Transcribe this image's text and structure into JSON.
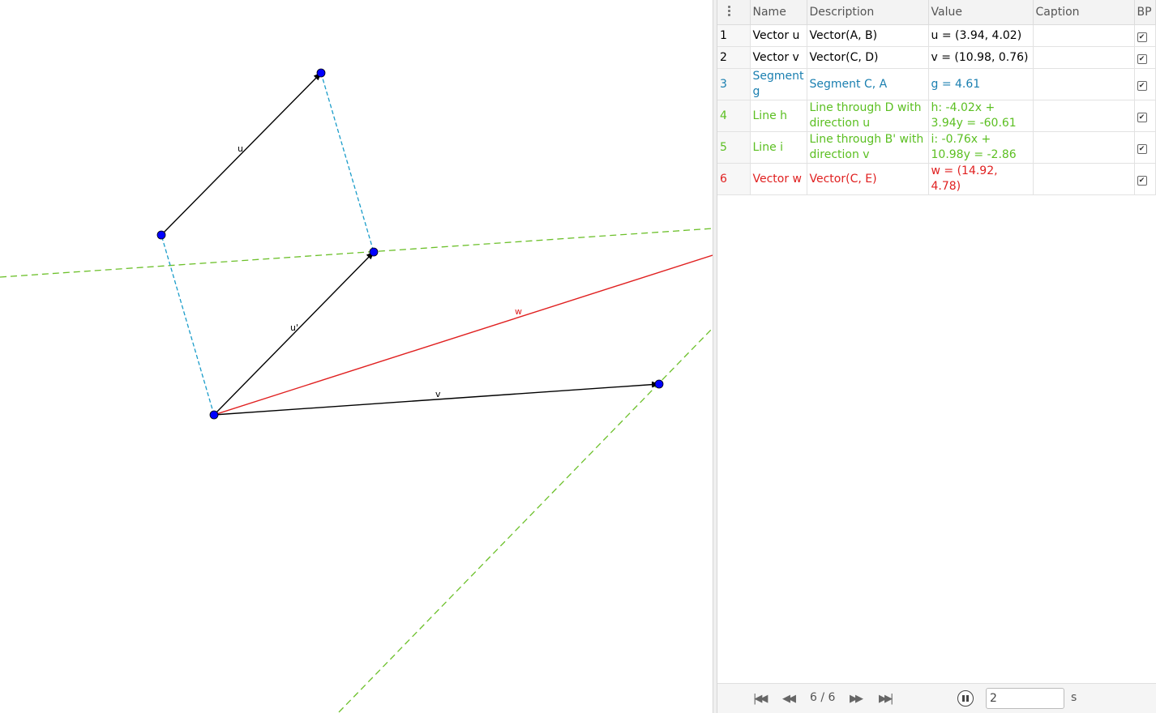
{
  "columns": {
    "name": "Name",
    "description": "Description",
    "value": "Value",
    "caption": "Caption",
    "bp": "BP"
  },
  "rows": [
    {
      "num": "1",
      "name": "Vector u",
      "description": "Vector(A, B)",
      "value": "u = (3.94, 4.02)",
      "caption": "",
      "color": "#000000"
    },
    {
      "num": "2",
      "name": "Vector v",
      "description": "Vector(C, D)",
      "value": "v = (10.98, 0.76)",
      "caption": "",
      "color": "#000000"
    },
    {
      "num": "3",
      "name": "Segment g",
      "description": "Segment C, A",
      "value": "g = 4.61",
      "caption": "",
      "color": "#1a7fb0"
    },
    {
      "num": "4",
      "name": "Line h",
      "description": "Line through D with direction u",
      "value": "h: -4.02x + 3.94y = -60.61",
      "caption": "",
      "color": "#5bbf21"
    },
    {
      "num": "5",
      "name": "Line i",
      "description": "Line through B' with direction v",
      "value": "i: -0.76x + 10.98y = -2.86",
      "caption": "",
      "color": "#5bbf21"
    },
    {
      "num": "6",
      "name": "Vector w",
      "description": "Vector(C, E)",
      "value": "w = (14.92, 4.78)",
      "caption": "",
      "color": "#e02020"
    }
  ],
  "graphics": {
    "labels": {
      "u": "u",
      "u_prime": "u'",
      "v": "v",
      "w": "w"
    },
    "colors": {
      "vector": "#000000",
      "segment": "#1a9cc9",
      "line": "#6cc02a",
      "w": "#e02020",
      "point": "#0000ff"
    }
  },
  "footer": {
    "counter": "6 / 6",
    "speed_value": "2",
    "speed_unit": "s"
  }
}
